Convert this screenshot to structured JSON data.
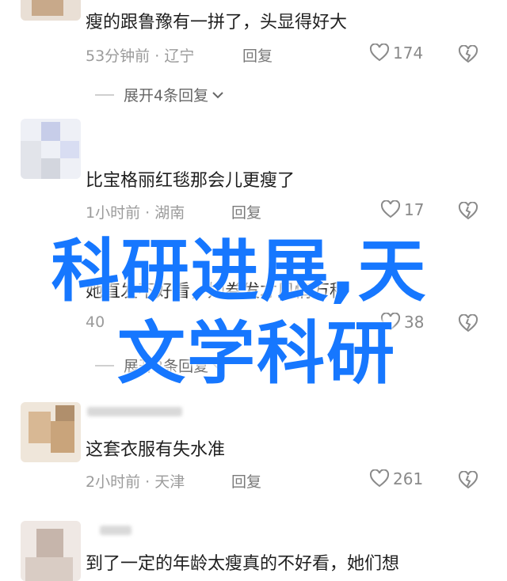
{
  "overlay": {
    "line1": "科研进展,天",
    "line2": "文学科研",
    "color": "#1677ff"
  },
  "comments": [
    {
      "text": "瘦的跟鲁豫有一拼了，头显得好大",
      "time": "53分钟前",
      "location": "辽宁",
      "reply_label": "回复",
      "likes": "174",
      "expand": "展开4条回复"
    },
    {
      "text": "比宝格丽红毯那会儿更瘦了",
      "time": "1小时前",
      "location": "湖南",
      "reply_label": "回复",
      "likes": "17"
    },
    {
      "text": "她直发不好看，她卷发才风情万种",
      "time": "40",
      "location": "",
      "reply_label": "",
      "likes": "38",
      "expand": "展开2条回复"
    },
    {
      "text": "这套衣服有失水准",
      "time": "2小时前",
      "location": "天津",
      "reply_label": "回复",
      "likes": "261"
    },
    {
      "text": "到了一定的年龄太瘦真的不好看，她们想"
    }
  ],
  "separator": " · ",
  "icons": {
    "like": "heart-outline-icon",
    "dislike": "broken-heart-icon",
    "expand": "chevron-down-icon"
  }
}
